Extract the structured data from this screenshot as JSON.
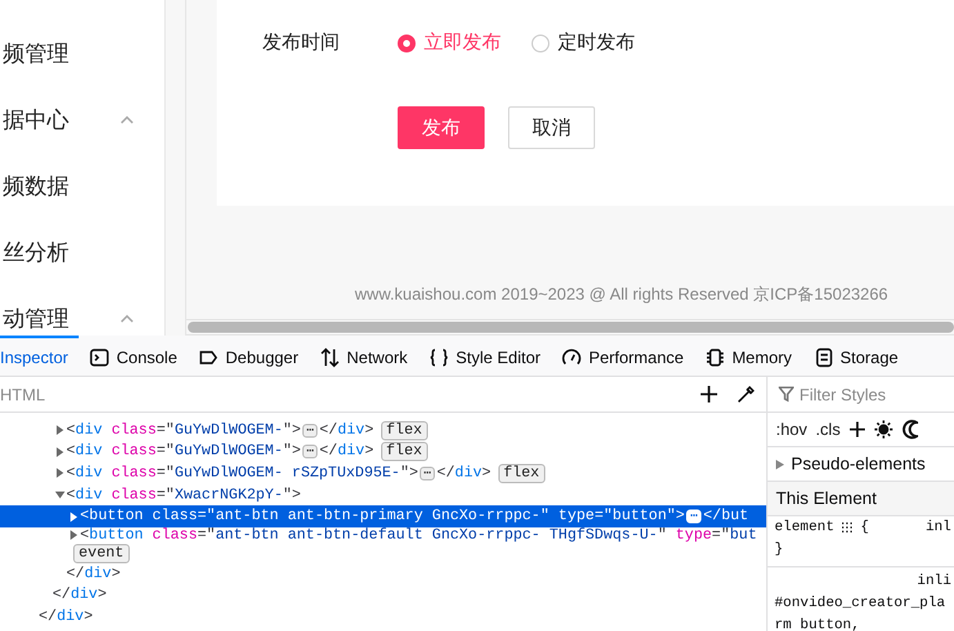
{
  "sidebar": {
    "items": [
      {
        "label": "频管理",
        "kind": "item"
      },
      {
        "label": "据中心",
        "kind": "group",
        "expanded": true
      },
      {
        "label": "频数据",
        "kind": "item"
      },
      {
        "label": "丝分析",
        "kind": "item"
      },
      {
        "label": "动管理",
        "kind": "group",
        "expanded": true
      }
    ]
  },
  "form": {
    "label": "发布时间",
    "options": [
      {
        "label": "立即发布",
        "selected": true
      },
      {
        "label": "定时发布",
        "selected": false
      }
    ],
    "buttons": [
      {
        "label": "发布",
        "kind": "primary"
      },
      {
        "label": "取消",
        "kind": "default"
      }
    ]
  },
  "footer": "www.kuaishou.com 2019~2023 @ All rights Reserved 京ICP备15023266",
  "devtools": {
    "tabs": [
      {
        "label": "Inspector",
        "kind": "inspector",
        "selected": true
      },
      {
        "label": "Console",
        "kind": "console",
        "selected": false
      },
      {
        "label": "Debugger",
        "kind": "debugger",
        "selected": false
      },
      {
        "label": "Network",
        "kind": "network",
        "selected": false
      },
      {
        "label": "Style Editor",
        "kind": "style",
        "selected": false
      },
      {
        "label": "Performance",
        "kind": "performance",
        "selected": false
      },
      {
        "label": "Memory",
        "kind": "memory",
        "selected": false
      },
      {
        "label": "Storage",
        "kind": "storage",
        "selected": false
      }
    ],
    "search": {
      "placeholder": "HTML"
    },
    "markup": [
      {
        "close": [
          {
            "kind": "punct",
            "text": "</"
          },
          {
            "kind": "tag",
            "text": "div"
          },
          {
            "kind": "punct",
            "text": ">"
          }
        ],
        "children": [
          {
            "close": [
              {
                "kind": "punct",
                "text": "</"
              },
              {
                "kind": "tag",
                "text": "div"
              },
              {
                "kind": "punct",
                "text": ">"
              }
            ],
            "children": [
              {
                "expanded": false,
                "selected": false,
                "badges": [
                  "flex"
                ],
                "tokens": [
                  {
                    "kind": "punct",
                    "text": "<"
                  },
                  {
                    "kind": "tag",
                    "text": "div"
                  },
                  {
                    "kind": "attr",
                    "text": " class"
                  },
                  {
                    "kind": "punct",
                    "text": "=\""
                  },
                  {
                    "kind": "value",
                    "text": "GuYwDlWOGEM-"
                  },
                  {
                    "kind": "punct",
                    "text": "\">"
                  },
                  {
                    "kind": "more",
                    "text": "⋯"
                  },
                  {
                    "kind": "punct",
                    "text": "</"
                  },
                  {
                    "kind": "tag",
                    "text": "div"
                  },
                  {
                    "kind": "punct",
                    "text": ">"
                  }
                ]
              },
              {
                "expanded": false,
                "selected": false,
                "badges": [
                  "flex"
                ],
                "tokens": [
                  {
                    "kind": "punct",
                    "text": "<"
                  },
                  {
                    "kind": "tag",
                    "text": "div"
                  },
                  {
                    "kind": "attr",
                    "text": " class"
                  },
                  {
                    "kind": "punct",
                    "text": "=\""
                  },
                  {
                    "kind": "value",
                    "text": "GuYwDlWOGEM-"
                  },
                  {
                    "kind": "punct",
                    "text": "\">"
                  },
                  {
                    "kind": "more",
                    "text": "⋯"
                  },
                  {
                    "kind": "punct",
                    "text": "</"
                  },
                  {
                    "kind": "tag",
                    "text": "div"
                  },
                  {
                    "kind": "punct",
                    "text": ">"
                  }
                ]
              },
              {
                "expanded": false,
                "selected": false,
                "badges": [
                  "flex"
                ],
                "tokens": [
                  {
                    "kind": "punct",
                    "text": "<"
                  },
                  {
                    "kind": "tag",
                    "text": "div"
                  },
                  {
                    "kind": "attr",
                    "text": " class"
                  },
                  {
                    "kind": "punct",
                    "text": "=\""
                  },
                  {
                    "kind": "value",
                    "text": "GuYwDlWOGEM- rSZpTUxD95E-"
                  },
                  {
                    "kind": "punct",
                    "text": "\">"
                  },
                  {
                    "kind": "more",
                    "text": "⋯"
                  },
                  {
                    "kind": "punct",
                    "text": "</"
                  },
                  {
                    "kind": "tag",
                    "text": "div"
                  },
                  {
                    "kind": "punct",
                    "text": ">"
                  }
                ]
              },
              {
                "expanded": true,
                "selected": false,
                "tokens": [
                  {
                    "kind": "punct",
                    "text": "<"
                  },
                  {
                    "kind": "tag",
                    "text": "div"
                  },
                  {
                    "kind": "attr",
                    "text": " class"
                  },
                  {
                    "kind": "punct",
                    "text": "=\""
                  },
                  {
                    "kind": "value",
                    "text": "XwacrNGK2pY-"
                  },
                  {
                    "kind": "punct",
                    "text": "\">"
                  }
                ],
                "close": [
                  {
                    "kind": "punct",
                    "text": "</"
                  },
                  {
                    "kind": "tag",
                    "text": "div"
                  },
                  {
                    "kind": "punct",
                    "text": ">"
                  }
                ],
                "children": [
                  {
                    "expanded": false,
                    "selected": true,
                    "tokens": [
                      {
                        "kind": "punct",
                        "text": "<"
                      },
                      {
                        "kind": "tag",
                        "text": "button"
                      },
                      {
                        "kind": "attr",
                        "text": " class"
                      },
                      {
                        "kind": "punct",
                        "text": "=\""
                      },
                      {
                        "kind": "value",
                        "text": "ant-btn ant-btn-primary GncXo-rrppc-"
                      },
                      {
                        "kind": "punct",
                        "text": "\""
                      },
                      {
                        "kind": "attr",
                        "text": " type"
                      },
                      {
                        "kind": "punct",
                        "text": "=\""
                      },
                      {
                        "kind": "value",
                        "text": "button"
                      },
                      {
                        "kind": "punct",
                        "text": "\">"
                      },
                      {
                        "kind": "more",
                        "text": "⋯"
                      },
                      {
                        "kind": "punct",
                        "text": "</"
                      },
                      {
                        "kind": "tag",
                        "text": "but"
                      }
                    ]
                  },
                  {
                    "expanded": false,
                    "selected": false,
                    "badges": [
                      "event"
                    ],
                    "tokens": [
                      {
                        "kind": "punct",
                        "text": "<"
                      },
                      {
                        "kind": "tag",
                        "text": "button"
                      },
                      {
                        "kind": "attr",
                        "text": " class"
                      },
                      {
                        "kind": "punct",
                        "text": "=\""
                      },
                      {
                        "kind": "value",
                        "text": "ant-btn ant-btn-default GncXo-rrppc- THgfSDwqs-U-"
                      },
                      {
                        "kind": "punct",
                        "text": "\""
                      },
                      {
                        "kind": "attr",
                        "text": " type"
                      },
                      {
                        "kind": "punct",
                        "text": "=\""
                      },
                      {
                        "kind": "value",
                        "text": "but"
                      }
                    ]
                  }
                ]
              }
            ]
          }
        ]
      }
    ],
    "styles": {
      "filter": {
        "placeholder": "Filter Styles"
      },
      "toggles": [
        ":hov",
        ".cls"
      ],
      "pseudo": "Pseudo-elements",
      "section": "This Element",
      "lines": [
        {
          "kind": "selector-row",
          "code": "element",
          "brace": "{",
          "source": "inl"
        },
        {
          "kind": "code",
          "code": "}"
        },
        {
          "kind": "source",
          "source": "inli"
        },
        {
          "kind": "code",
          "code": "#onvideo_creator_pla"
        },
        {
          "kind": "code",
          "code": "rm button,"
        }
      ]
    }
  }
}
